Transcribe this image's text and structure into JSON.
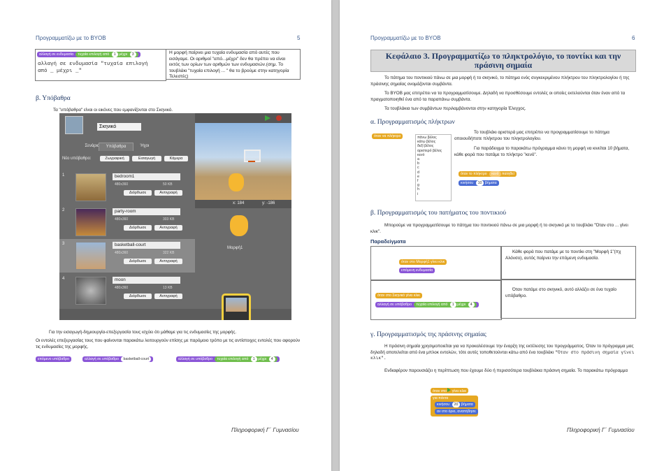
{
  "header": "Προγραμματίζω με το BYOB",
  "footer": "Πληροφορική Γ΄ Γυμνασίου",
  "left": {
    "page_num": "5",
    "block_switch": "αλλαγή σε ενδυμασία",
    "block_random": "τυχαία επιλογή από",
    "block_to": "μέχρι",
    "n1": "1",
    "n3": "3",
    "code_line1": "αλλαγή σε ενδυμασία \"τυχαία επιλογή",
    "code_line2": "από _ μέχρι _\"",
    "desc": "Η μορφή παίρνει μια τυχαία ενδυμασία από αυτές που εισάγαμε. Οι αριθμοί \"από...μέχρι\" δεν θα πρέπει να είναι εκτός των ορίων των αριθμών των ενδυμασιών.(σημ. Το τουβλάκι \"τυχαία επιλογή ... \" θα το βρούμε στην κατηγορία Τελεστές)",
    "section_b": "β. Υπόβαθρα",
    "backdrops_text": "Τα \"υπόβαθρα\" είναι οι εικόνες που εμφανίζονται στο Σκηνικό.",
    "caption1": "Για την εισαγωγή-δημιουργία-επεξεργασία τους ισχύει ότι μάθαμε για τις ενδυμασίες της μορφής.",
    "caption2": "Οι εντολές επεξεργασίας τους που φαίνονται παρακάτω λειτουργούν επίσης με παρόμοιο τρόπο με τις αντίστοιχες εντολές που αφορούν τις ενδυμασίες της μορφής.",
    "block_next": "επόμενο υπόβαθρο",
    "block_switch_bg": "αλλαγή σε υπόβαθρο",
    "bg_value": "basketball-court",
    "n4": "4",
    "scratch": {
      "title": "Σκηνικό",
      "tabs": [
        "Σενάρια",
        "Υπόβαθρα",
        "Ήχοι"
      ],
      "new_bg": "Νέο υπόβαθρο:",
      "new_btns": [
        "Ζωγραφική",
        "Εισαγωγή",
        "Κάμερα"
      ],
      "costumes": [
        {
          "num": "1",
          "name": "bedroom1",
          "dims": "480x360",
          "size": "50 KB"
        },
        {
          "num": "2",
          "name": "party-room",
          "dims": "480x360",
          "size": "303 KB"
        },
        {
          "num": "3",
          "name": "basketball-court",
          "dims": "480x360",
          "size": "322 KB"
        },
        {
          "num": "4",
          "name": "moon",
          "dims": "480x360",
          "size": "13 KB"
        }
      ],
      "edit": "Διόρθωσε",
      "copy": "Αντιγραφή",
      "x_label": "x: 184",
      "y_label": "y: -186",
      "sprite": "Μορφή1",
      "stage": "Σκηνικό"
    }
  },
  "right": {
    "page_num": "6",
    "chapter": "Κεφάλαιο 3. Προγραμματίζω το πληκτρολόγιο, το ποντίκι και την πράσινη σημαία",
    "p1": "Το πάτημα του ποντικιού πάνω σε μια μορφή ή το σκηνικό, το πάτημα ενός συγκεκριμένου πλήκτρου του πληκτρολογίου ή της πράσινης σημαίας ονομάζονται συμβάντα.",
    "p2": "Το BYOB μας επιτρέπει να τα προγραμματίσουμε. Δηλαδή να προσθέσουμε εντολές οι οποίες εκτελούνται όταν έναν από τα πραγματοποιηθεί ένα από τα παραπάνω συμβάντα.",
    "p3": "Τα τουβλάκια των συμβάντων περιλαμβάνονται στην κατηγορία Έλεγχος.",
    "sec_a": "α. Προγραμματισμός πλήκτρων",
    "key_block": "όταν να πλήκτρο",
    "key_list": [
      "πάνω βέλος",
      "κάτω βέλος",
      "δεξί βέλος",
      "αριστερό βέλος",
      "κενό",
      "a",
      "b",
      "c",
      "d",
      "e",
      "f",
      "g",
      "h",
      "i"
    ],
    "a_text1": "Το τουβλάκι αριστερά μας επιτρέπει να προγραμματίσουμε το πάτημα οποιουδήποτε πλήκτρου του πληκτρολογίου.",
    "a_text2": "Για παράδειγμα το παρακάτω πρόγραμμα κάνει τη μορφή να κινείται 10 βήματα, κάθε φορά που πατάμε το πλήκτρο \"κενό\".",
    "blk_when_key": "όταν το πλήκτρο",
    "key_val": "κενό",
    "blk_pressed": "πατηθεί",
    "blk_move": "κινήσου",
    "move_val": "10",
    "blk_steps": "βήματα",
    "sec_b": "β. Προγραμματισμός του πατήματος του ποντικιού",
    "b_text": "Μπορούμε να προγραμματίσουμε το πάτημα του ποντικιού πάνω σε μια μορφή ή το σκηνικό με το τουβλάκι \"Όταν στο ... γίνει κλικ\".",
    "examples": "Παραδείγματα",
    "ex1_b1": "όταν στο Μορφή1 γίνει κλικ",
    "ex1_b2": "επόμενη ενδυμασία",
    "ex1_text": "Κάθε φορά που πατάμε με το ποντίκι στη \"Μορφή 1\"(πχ Αλόνσο), αυτός παίρνει την επόμενη ενδυμασία.",
    "ex2_b1": "όταν στο Σκηνικό γίνει κλικ",
    "ex2_b2": "αλλαγή σε υπόβαθρο",
    "ex2_rand": "τυχαία επιλογή από",
    "ex2_to": "μέχρι",
    "ex2_n1": "1",
    "ex2_n4": "4",
    "ex2_text": "Όταν πατάμε στο σκηνικό, αυτό αλλάζει σε ένα τυχαίο υπόβαθρο.",
    "sec_c": "γ. Προγραμματισμός της πράσινης σημαίας",
    "c_text1": "Η πράσινη σημαία χρησιμοποιείται για να προκαλέσουμε την έναρξη της εκτέλεσης του προγράμματος. Όταν το πρόγραμμα μας δηλαδή αποτελείται από ένα μπλοκ εντολών, τότε αυτές τοποθετούνται κάτω από ένα τουβλάκι",
    "c_code": "\"Όταν στο πράσινη σημαία γίνει κλικ\".",
    "c_text2": "Ενδιαφέρον παρουσιάζει η περίπτωση που έχουμε δύο ή περισσότερα τουβλάκια πράσινη σημαία. Το παρακάτω πρόγραμμα",
    "g_b1": "όταν στο",
    "g_b1b": "γίνει κλικ",
    "g_b2": "κινήσου",
    "g_val": "20",
    "g_b2b": "βήματα",
    "g_b3": "για πάντα",
    "g_b4": "αν στο όριο, αναπήδησε"
  }
}
